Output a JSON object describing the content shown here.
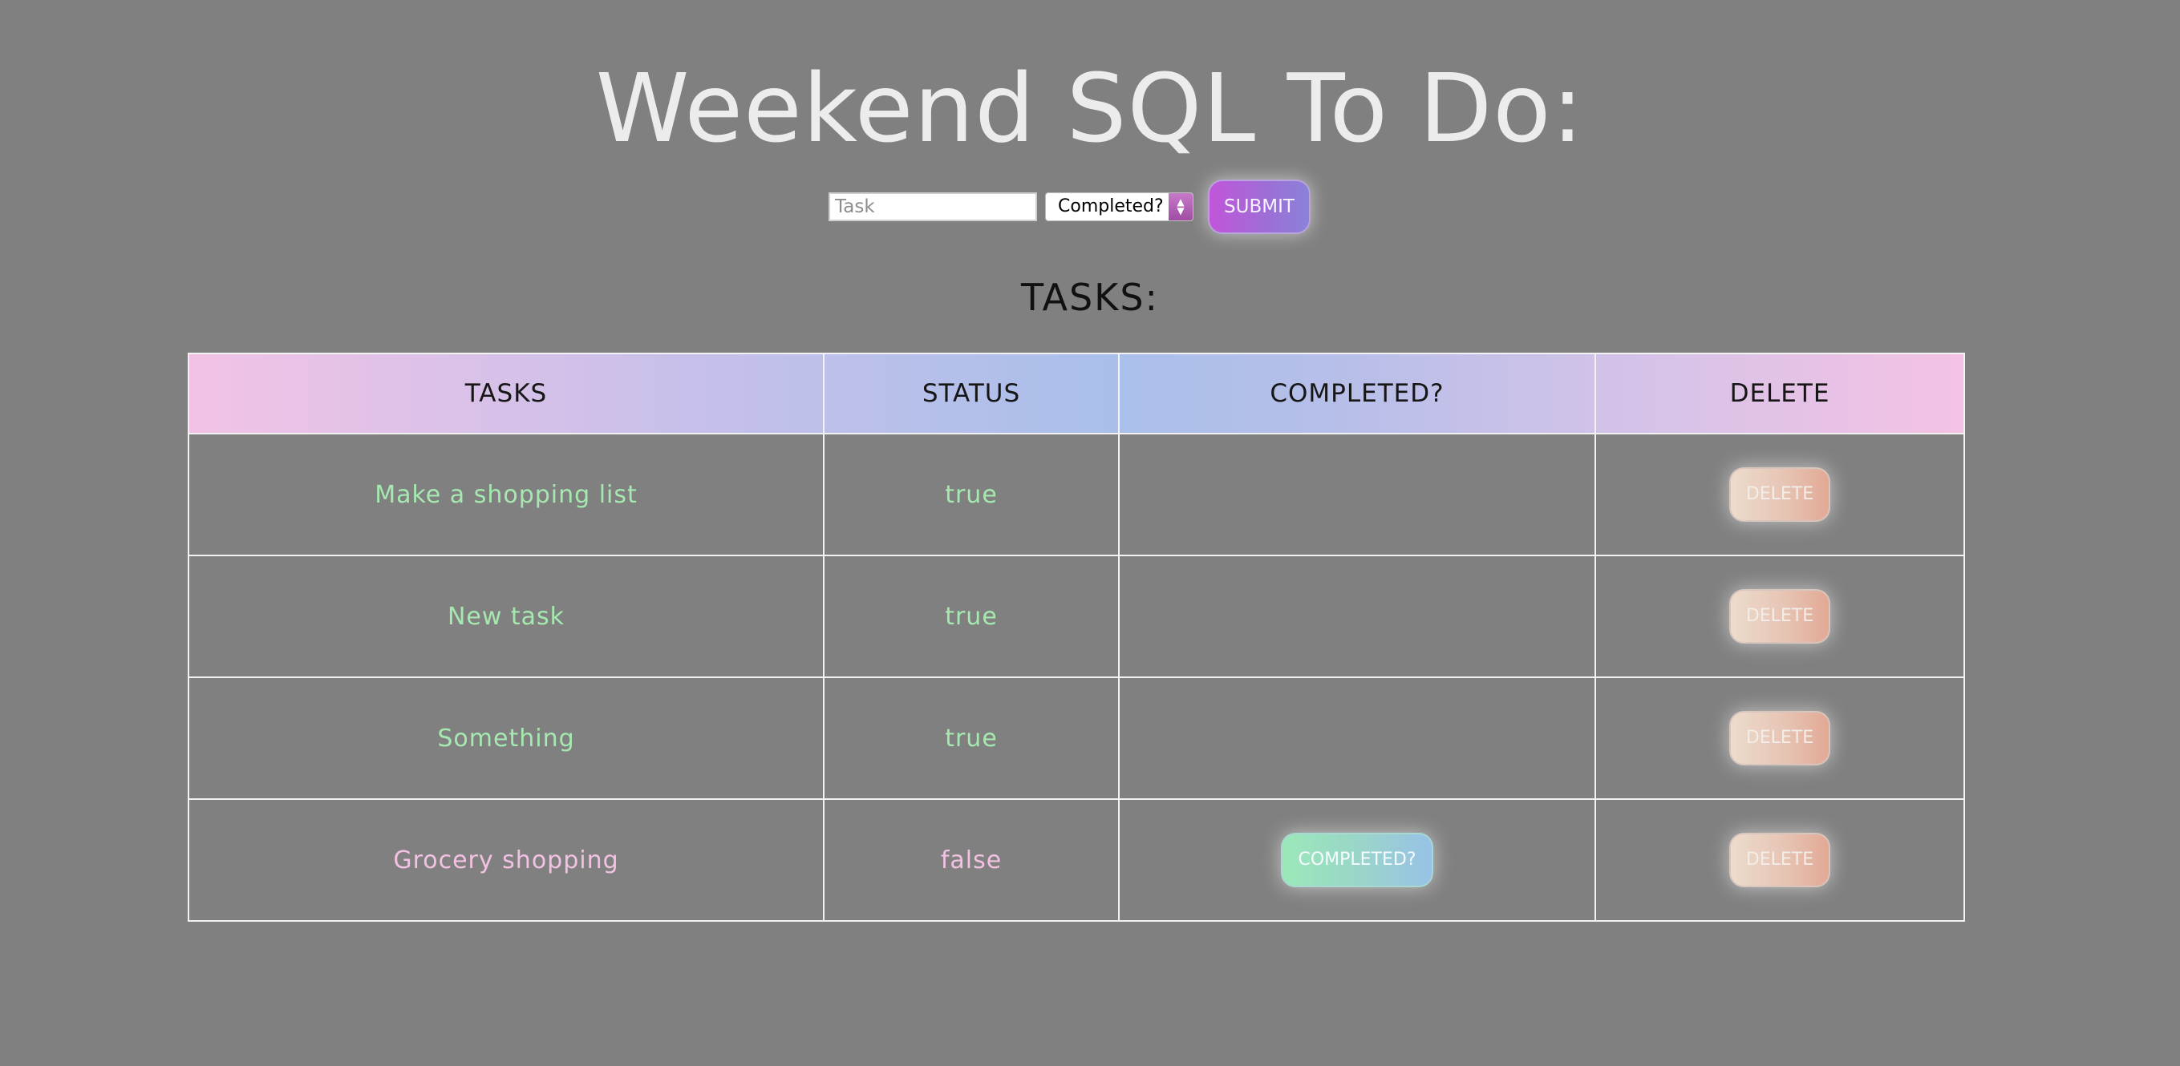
{
  "header": {
    "title": "Weekend SQL To Do:"
  },
  "form": {
    "task_placeholder": "Task",
    "task_value": "",
    "completed_select_value": "Completed?",
    "submit_label": "SUBMIT"
  },
  "tasks_section": {
    "heading": "TASKS:"
  },
  "table": {
    "columns": [
      "TASKS",
      "STATUS",
      "COMPLETED?",
      "DELETE"
    ],
    "rows": [
      {
        "task": "Make a shopping list",
        "status": "true",
        "completed_button": "",
        "delete_label": "DELETE"
      },
      {
        "task": "New task",
        "status": "true",
        "completed_button": "",
        "delete_label": "DELETE"
      },
      {
        "task": "Something",
        "status": "true",
        "completed_button": "",
        "delete_label": "DELETE"
      },
      {
        "task": "Grocery shopping",
        "status": "false",
        "completed_button": "COMPLETED?",
        "delete_label": "DELETE"
      }
    ]
  },
  "colors": {
    "background": "#808080",
    "done_text": "#a6e9b0",
    "not_done_text": "#f3c2e2",
    "submit_gradient_start": "#c155d9",
    "submit_gradient_end": "#8a82d8"
  }
}
